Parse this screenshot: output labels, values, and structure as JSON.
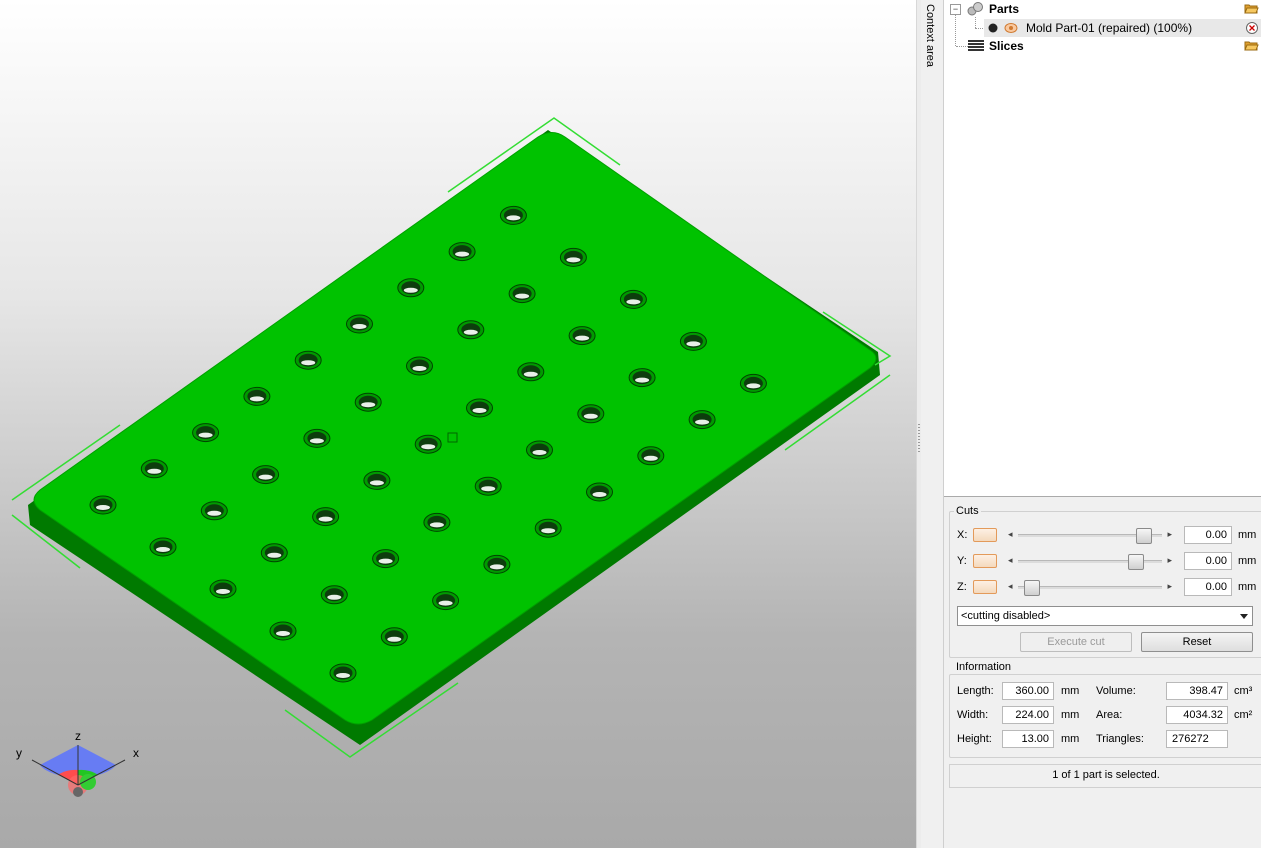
{
  "viewport": {
    "axes": {
      "x": "x",
      "y": "y",
      "z": "z"
    },
    "model_color": "#00c000",
    "selection_color": "#33cc33"
  },
  "context_tab": {
    "label": "Context area"
  },
  "tree": {
    "parts_label": "Parts",
    "part_item_label": "Mold Part-01 (repaired) (100%)",
    "slices_label": "Slices"
  },
  "cuts": {
    "title": "Cuts",
    "x": {
      "label": "X:",
      "value": "0.00",
      "unit": "mm",
      "slider_level": 0.85
    },
    "y": {
      "label": "Y:",
      "value": "0.00",
      "unit": "mm",
      "slider_level": 0.8
    },
    "z": {
      "label": "Z:",
      "value": "0.00",
      "unit": "mm",
      "slider_level": 0.1
    },
    "mode": "<cutting disabled>",
    "execute_label": "Execute cut",
    "reset_label": "Reset"
  },
  "information": {
    "title": "Information",
    "length_label": "Length:",
    "length_value": "360.00",
    "length_unit": "mm",
    "width_label": "Width:",
    "width_value": "224.00",
    "width_unit": "mm",
    "height_label": "Height:",
    "height_value": "13.00",
    "height_unit": "mm",
    "volume_label": "Volume:",
    "volume_value": "398.47",
    "volume_unit": "cm³",
    "area_label": "Area:",
    "area_value": "4034.32",
    "area_unit": "cm²",
    "triangles_label": "Triangles:",
    "triangles_value": "276272"
  },
  "status": {
    "text": "1 of 1 part is selected."
  }
}
